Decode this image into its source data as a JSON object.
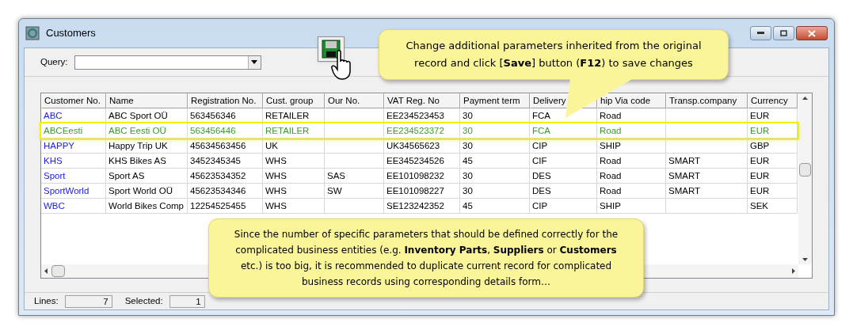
{
  "window": {
    "title": "Customers"
  },
  "query": {
    "label": "Query:"
  },
  "table": {
    "columns": [
      "Customer No.",
      "Name",
      "Registration No.",
      "Cust. group",
      "Our No.",
      "VAT Reg. No",
      "Payment term",
      "Delivery",
      "hip Via code",
      "Transp.company",
      "Currency"
    ],
    "rows": [
      {
        "selected": false,
        "cells": [
          "ABC",
          "ABC Sport OÜ",
          "563456346",
          "RETAILER",
          "",
          "EE234523453",
          "30",
          "FCA",
          "Road",
          "",
          "EUR"
        ]
      },
      {
        "selected": true,
        "cells": [
          "ABCEesti",
          "ABC Eesti OÜ",
          "563456446",
          "RETAILER",
          "",
          "EE234523372",
          "30",
          "FCA",
          "Road",
          "",
          "EUR"
        ]
      },
      {
        "selected": false,
        "cells": [
          "HAPPY",
          "Happy Trip UK",
          "45634563456",
          "UK",
          "",
          "UK34565623",
          "30",
          "CIP",
          "SHIP",
          "",
          "GBP"
        ]
      },
      {
        "selected": false,
        "cells": [
          "KHS",
          "KHS Bikes AS",
          "3452345345",
          "WHS",
          "",
          "EE345234526",
          "45",
          "CIF",
          "Road",
          "SMART",
          "EUR"
        ]
      },
      {
        "selected": false,
        "cells": [
          "Sport",
          "Sport AS",
          "45623534352",
          "WHS",
          "SAS",
          "EE101098232",
          "30",
          "DES",
          "Road",
          "SMART",
          "EUR"
        ]
      },
      {
        "selected": false,
        "cells": [
          "SportWorld",
          "Sport World OÜ",
          "45623534346",
          "WHS",
          "SW",
          "EE101098227",
          "30",
          "DES",
          "Road",
          "SMART",
          "EUR"
        ]
      },
      {
        "selected": false,
        "cells": [
          "WBC",
          "World Bikes Comp",
          "12254525455",
          "WHS",
          "",
          "SE123242352",
          "45",
          "CIP",
          "SHIP",
          "",
          "SEK"
        ]
      }
    ]
  },
  "status_bar": {
    "lines_label": "Lines:",
    "lines": "7",
    "selected_label": "Selected:",
    "selected": "1"
  },
  "callouts": [
    "Change additional parameters inherited from the original record and click [**Save**] button (**F12**) to save changes",
    "Since the number of specific parameters that should be defined correctly for the complicated business entities (e.g. **Inventory Parts**, **Suppliers** or **Customers** etc.) is too big, it is recommended to duplicate current record for complicated business records using corresponding details form…"
  ]
}
